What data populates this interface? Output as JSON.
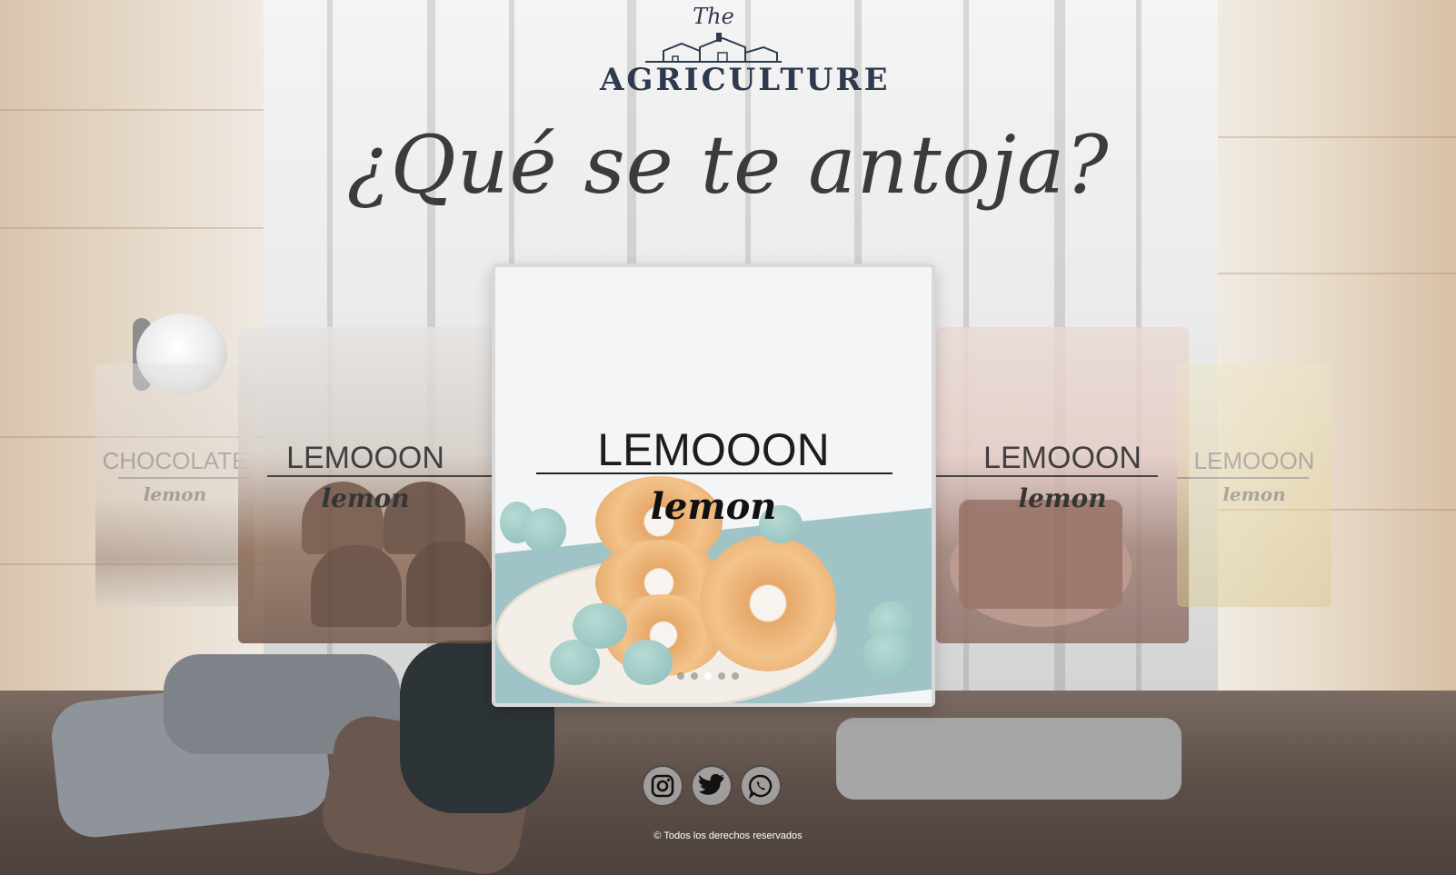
{
  "logo": {
    "top_text": "The",
    "brand": "AGRICULTURE"
  },
  "headline": "¿Qué se te antoja?",
  "carousel": {
    "slides": [
      {
        "title": "CHOCOLATE",
        "subtitle": "lemon"
      },
      {
        "title": "LEMOOON",
        "subtitle": "lemon"
      },
      {
        "title": "LEMOOON",
        "subtitle": "lemon"
      },
      {
        "title": "LEMOOON",
        "subtitle": "lemon"
      },
      {
        "title": "LEMOOON",
        "subtitle": "lemon"
      }
    ],
    "active_index": 2
  },
  "social": [
    {
      "name": "instagram-icon"
    },
    {
      "name": "twitter-icon"
    },
    {
      "name": "whatsapp-icon"
    }
  ],
  "footer": "© Todos los derechos reservados",
  "colors": {
    "headline": "#3b3b3b",
    "brand": "#2e3a4d"
  }
}
